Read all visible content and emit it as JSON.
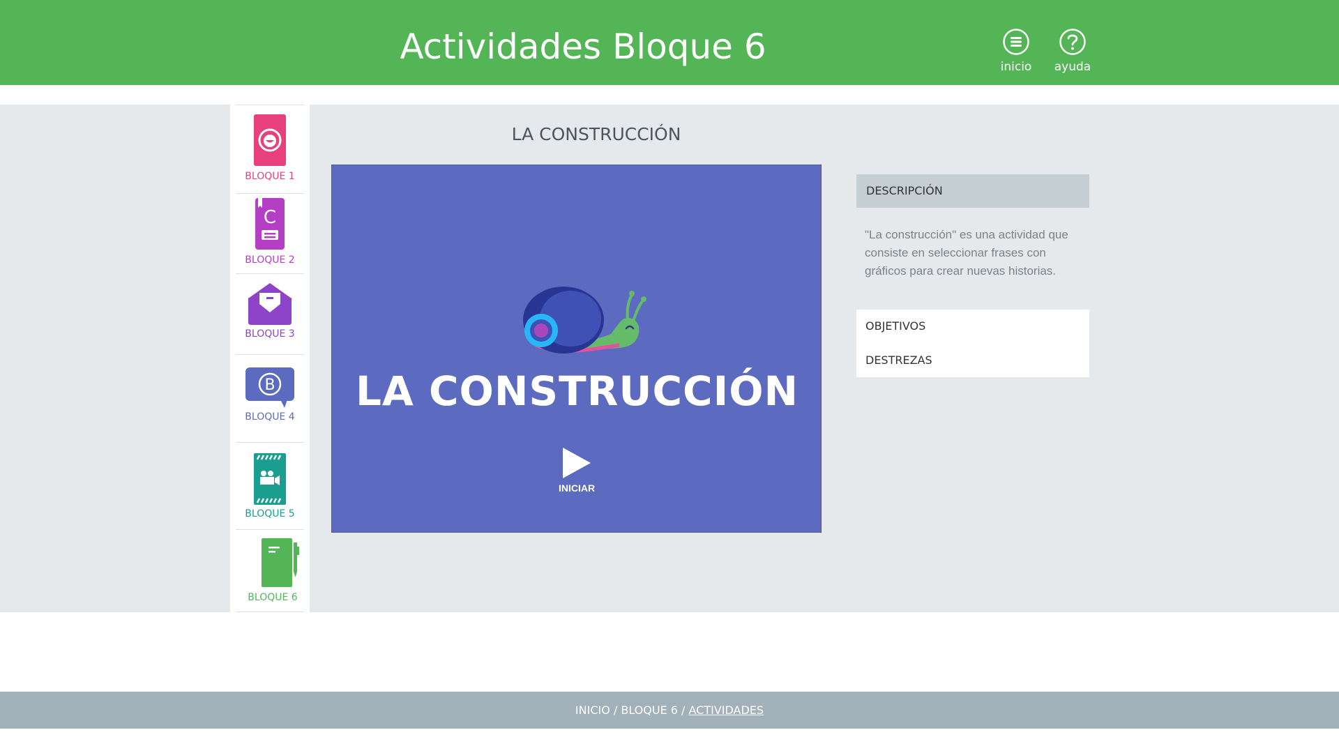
{
  "header": {
    "title": "Actividades Bloque 6",
    "inicio_label": "inicio",
    "ayuda_label": "ayuda"
  },
  "sidebar": {
    "items": [
      {
        "label": "BLOQUE 1",
        "color": "#e8407a",
        "icon": "portrait-card-icon"
      },
      {
        "label": "BLOQUE 2",
        "color": "#b43fc4",
        "icon": "letter-c-book-icon"
      },
      {
        "label": "BLOQUE 3",
        "color": "#8e44c9",
        "icon": "envelope-heart-icon"
      },
      {
        "label": "BLOQUE 4",
        "color": "#5c6bc0",
        "icon": "speech-bubble-b-icon"
      },
      {
        "label": "BLOQUE 5",
        "color": "#1a9e8f",
        "icon": "clapperboard-icon"
      },
      {
        "label": "BLOQUE 6",
        "color": "#54b556",
        "icon": "notebook-pen-icon"
      }
    ]
  },
  "activity": {
    "title": "LA CONSTRUCCIÓN",
    "stage_heading": "LA CONSTRUCCIÓN",
    "play_label": "INICIAR",
    "stage_color": "#5c6bc0"
  },
  "panel": {
    "description_heading": "DESCRIPCIÓN",
    "description_text": "\"La construcción\" es una actividad que consiste en seleccionar frases con gráficos para crear nuevas historias.",
    "links": [
      "OBJETIVOS",
      "DESTREZAS"
    ]
  },
  "footer": {
    "crumb_prefix": "INICIO / BLOQUE 6 / ",
    "crumb_current": "ACTIVIDADES"
  },
  "colors": {
    "header": "#54b556",
    "band": "#e6e9ec",
    "footer": "#a1b0b9"
  }
}
